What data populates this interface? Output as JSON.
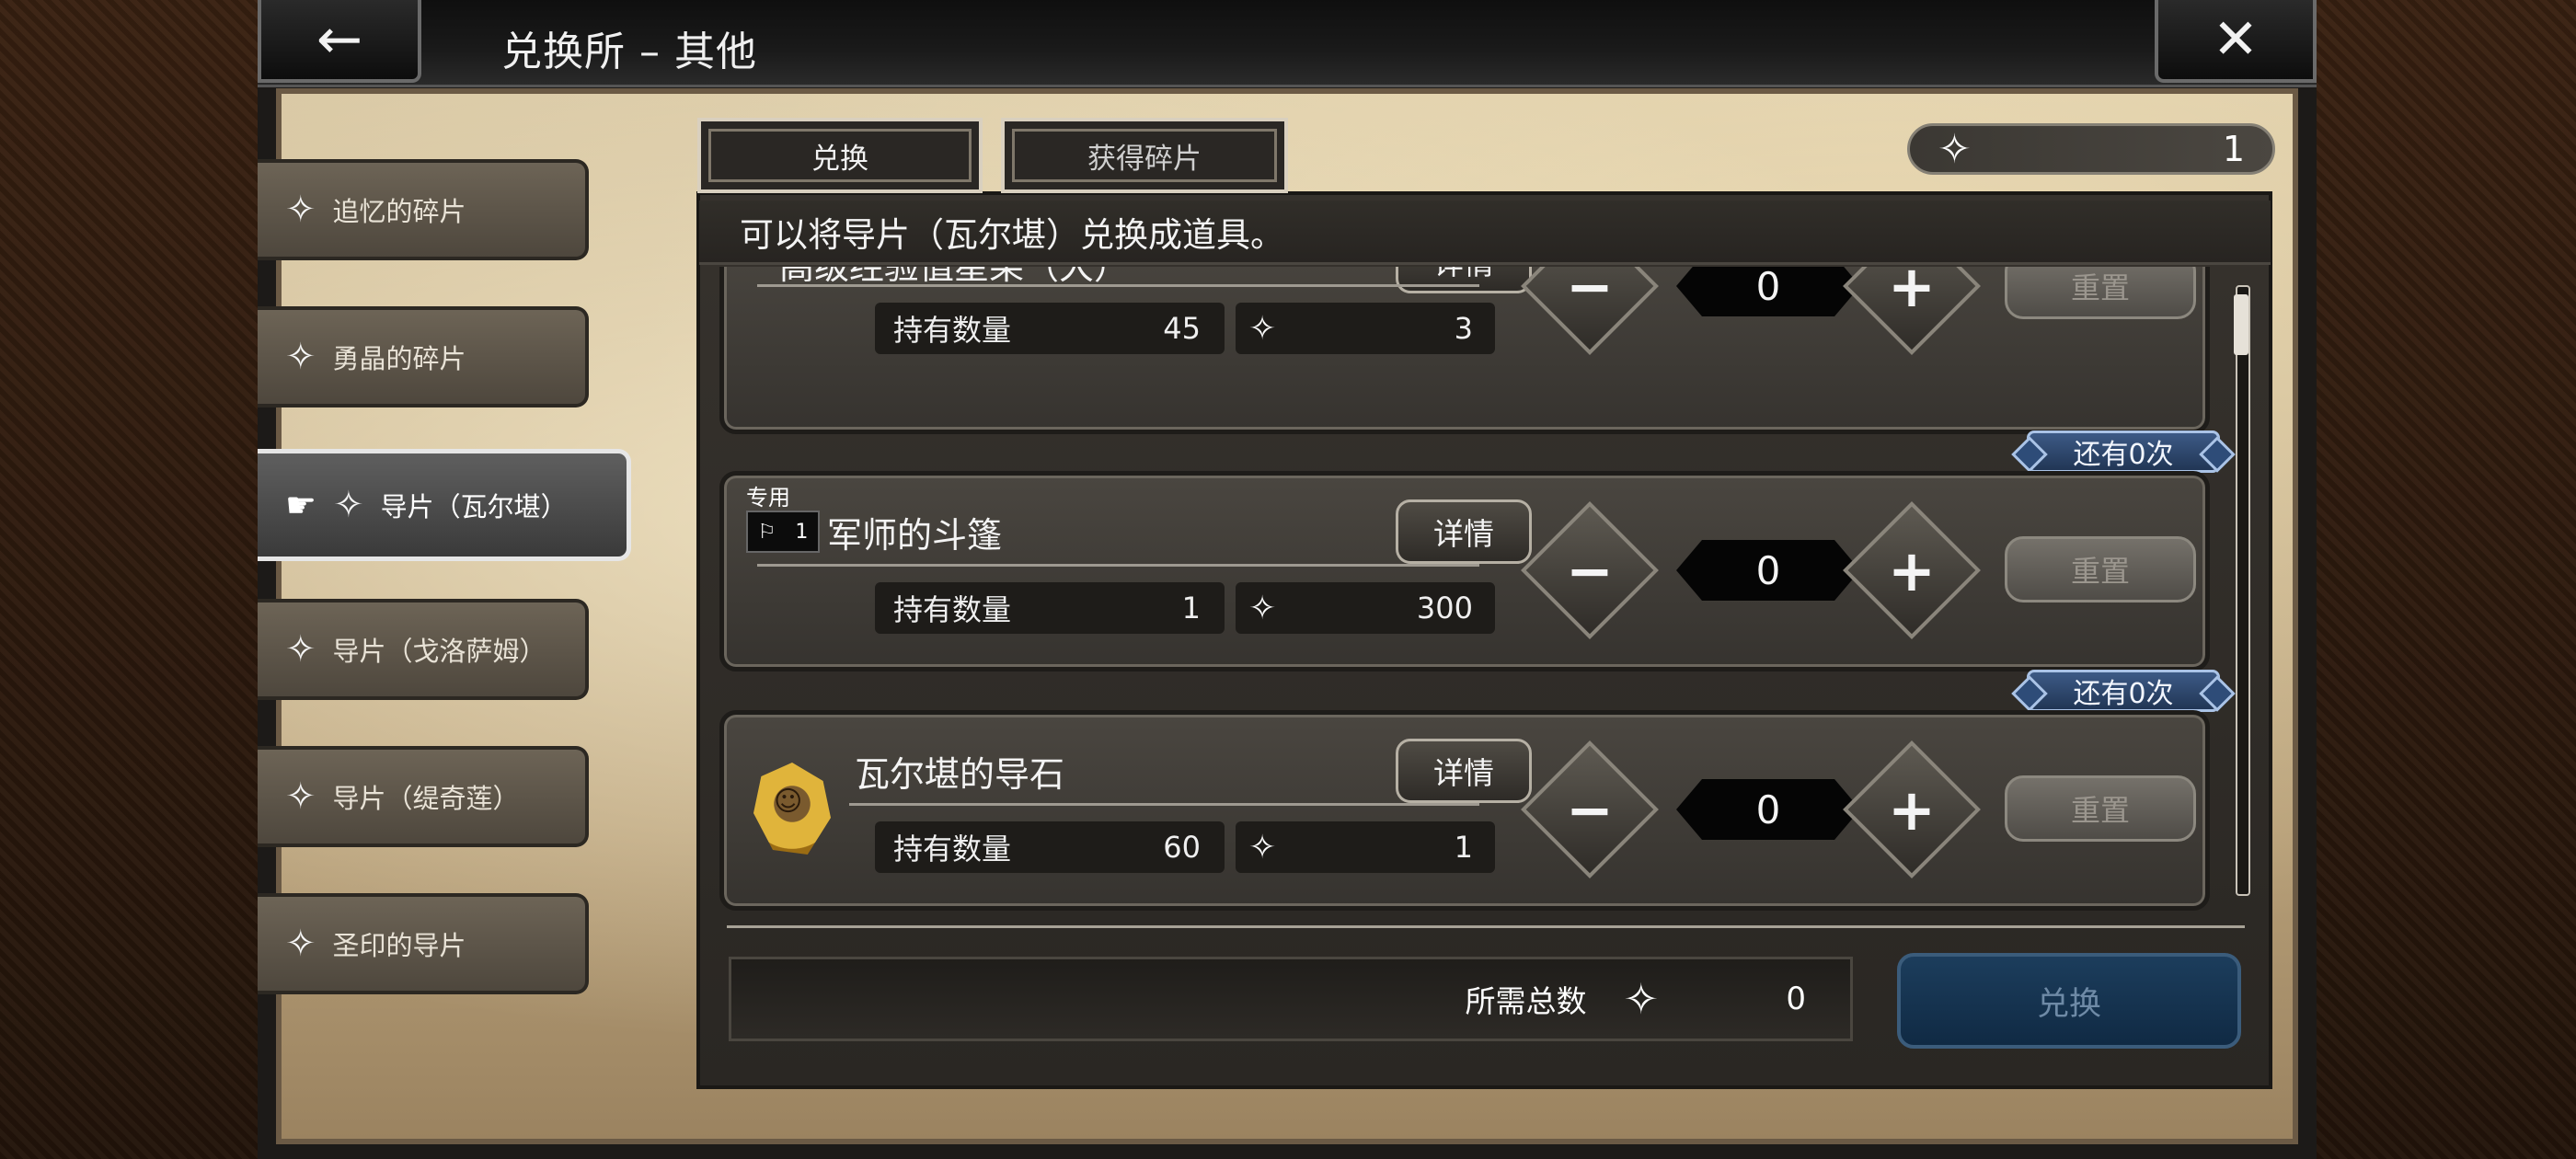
{
  "header": {
    "title": "兑换所 – 其他",
    "back_icon": "arrow-left-icon",
    "close_icon": "close-x-icon"
  },
  "sidebar": {
    "items": [
      {
        "label": "追忆的碎片",
        "active": false
      },
      {
        "label": "勇晶的碎片",
        "active": false
      },
      {
        "label": "导片（瓦尔堪）",
        "active": true
      },
      {
        "label": "导片（戈洛萨姆）",
        "active": false
      },
      {
        "label": "导片（缇奇莲）",
        "active": false
      },
      {
        "label": "圣印的导片",
        "active": false
      }
    ]
  },
  "tabs": [
    {
      "label": "兑换",
      "active": true
    },
    {
      "label": "获得碎片",
      "active": false
    }
  ],
  "currency": {
    "amount": "1"
  },
  "description": "可以将导片（瓦尔堪）兑换成道具。",
  "list": {
    "hold_label": "持有数量",
    "detail_label": "详情",
    "reset_label": "重置",
    "items": [
      {
        "name": "高级经验值星果（大）",
        "held": "45",
        "cost": "3",
        "qty": "0",
        "limit": ""
      },
      {
        "name": "军师的斗篷",
        "held": "1",
        "cost": "300",
        "qty": "0",
        "limit": "还有0次",
        "tag": "专用",
        "tag_count": "1"
      },
      {
        "name": "瓦尔堪的导石",
        "held": "60",
        "cost": "1",
        "qty": "0",
        "limit": "还有0次"
      }
    ]
  },
  "footer": {
    "total_label": "所需总数",
    "total_value": "0",
    "exchange_label": "兑换"
  },
  "colors": {
    "badge_blue": "#2e4c78",
    "exchange_btn": "#1c3d5c",
    "parchment": "#d8c7a3"
  }
}
